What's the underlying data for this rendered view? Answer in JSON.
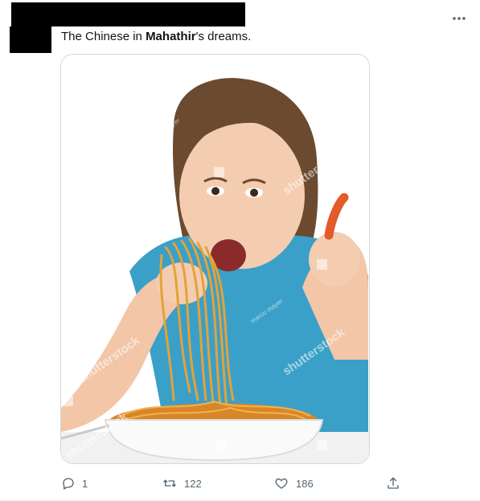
{
  "tweet": {
    "text_before": "The Chinese in ",
    "text_mention": "Mahathir",
    "text_after": "'s dreams.",
    "more_icon": "ellipsis-icon"
  },
  "media": {
    "watermarks": [
      "shutterstock",
      "shutterstock",
      "shutterstock",
      "shutterstock",
      "shutterstock",
      "shutterstock"
    ],
    "credits": [
      "marco mayer",
      "marco mayer",
      "marco mayer"
    ]
  },
  "actions": {
    "reply": {
      "icon": "reply-icon",
      "count": "1"
    },
    "retweet": {
      "icon": "retweet-icon",
      "count": "122"
    },
    "like": {
      "icon": "heart-icon",
      "count": "186"
    },
    "share": {
      "icon": "share-icon"
    }
  },
  "colors": {
    "text": "#0f1419",
    "secondary": "#536471",
    "border": "#cfd9de",
    "shirt": "#3aa0c8",
    "hair": "#6b4a30",
    "noodles": "#e3a23a"
  }
}
